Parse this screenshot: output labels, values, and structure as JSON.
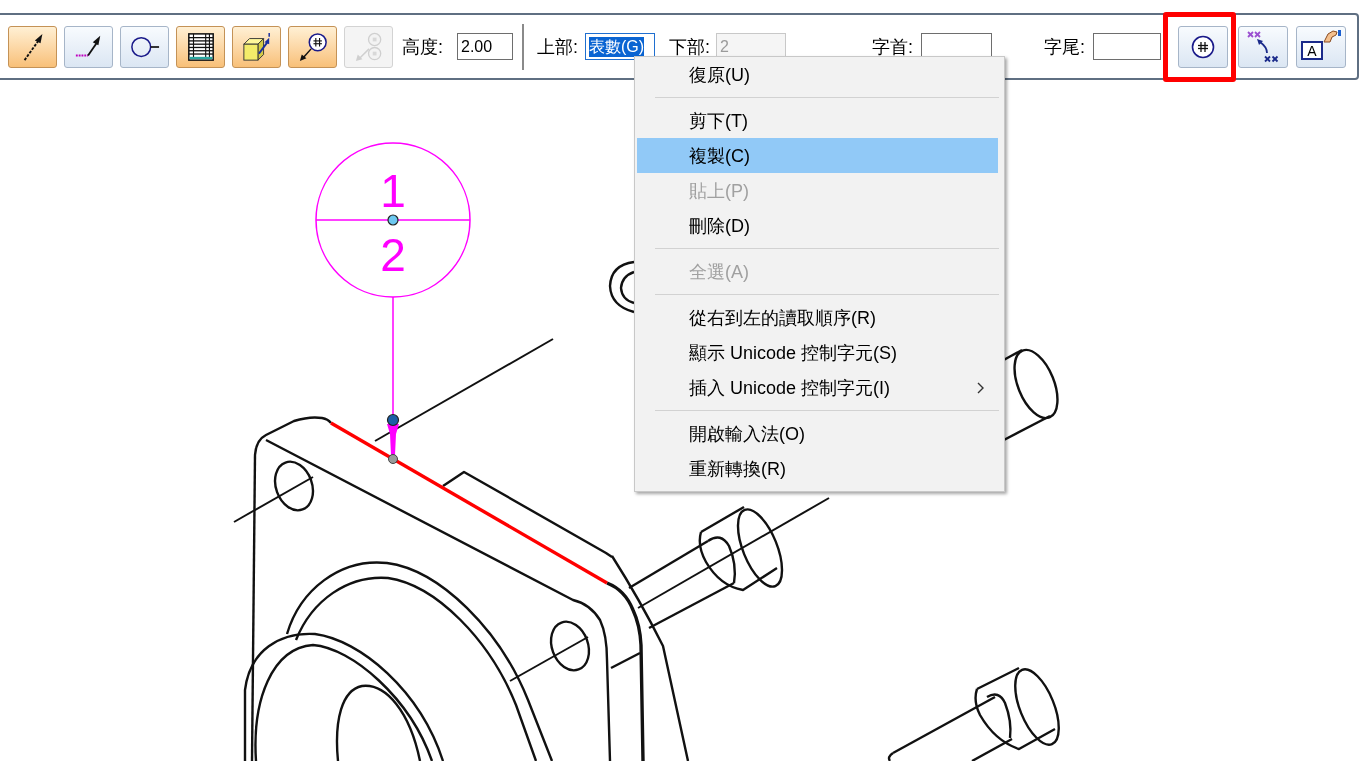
{
  "toolbar": {
    "left_buttons": [
      {
        "on": true,
        "disabled": false
      },
      {
        "on": false,
        "disabled": false
      },
      {
        "on": false,
        "disabled": false
      },
      {
        "on": true,
        "disabled": false
      },
      {
        "on": true,
        "disabled": false
      },
      {
        "on": true,
        "disabled": false
      },
      {
        "on": false,
        "disabled": true
      }
    ],
    "fields": [
      {
        "label": "高度:",
        "value": "2.00",
        "disabled": false,
        "text_selected": false
      },
      {
        "label": "上部:",
        "value": "表數(G)",
        "disabled": false,
        "text_selected": true
      },
      {
        "label": "下部:",
        "value": "2",
        "disabled": true,
        "text_selected": false
      },
      {
        "label": "字首:",
        "disabled": false,
        "text_selected": false
      },
      {
        "label": "字尾:",
        "disabled": false,
        "text_selected": false
      }
    ],
    "right_buttons": [
      {
        "on": false,
        "highlighted": true
      },
      {
        "on": false,
        "highlighted": false
      },
      {
        "on": false,
        "highlighted": false,
        "glyph": "A"
      }
    ]
  },
  "drawing": {
    "balloon": {
      "upper": "1",
      "lower": "2"
    },
    "edge_highlighted": true
  },
  "context_menu": {
    "groups": [
      {
        "items": [
          {
            "label": "復原(U)",
            "selected": false,
            "disabled": false,
            "submenu": false
          }
        ]
      },
      {
        "items": [
          {
            "label": "剪下(T)",
            "selected": false,
            "disabled": false,
            "submenu": false
          },
          {
            "label": "複製(C)",
            "selected": true,
            "disabled": false,
            "submenu": false
          },
          {
            "label": "貼上(P)",
            "selected": false,
            "disabled": true,
            "submenu": false
          },
          {
            "label": "刪除(D)",
            "selected": false,
            "disabled": false,
            "submenu": false
          }
        ]
      },
      {
        "items": [
          {
            "label": "全選(A)",
            "selected": false,
            "disabled": true,
            "submenu": false
          }
        ]
      },
      {
        "items": [
          {
            "label": "從右到左的讀取順序(R)",
            "selected": false,
            "disabled": false,
            "submenu": false
          },
          {
            "label": "顯示 Unicode 控制字元(S)",
            "selected": false,
            "disabled": false,
            "submenu": false
          },
          {
            "label": "插入 Unicode 控制字元(I)",
            "selected": false,
            "disabled": false,
            "submenu": true
          }
        ]
      },
      {
        "items": [
          {
            "label": "開啟輸入法(O)",
            "selected": false,
            "disabled": false,
            "submenu": false
          },
          {
            "label": "重新轉換(R)",
            "selected": false,
            "disabled": false,
            "submenu": false
          }
        ]
      }
    ]
  }
}
